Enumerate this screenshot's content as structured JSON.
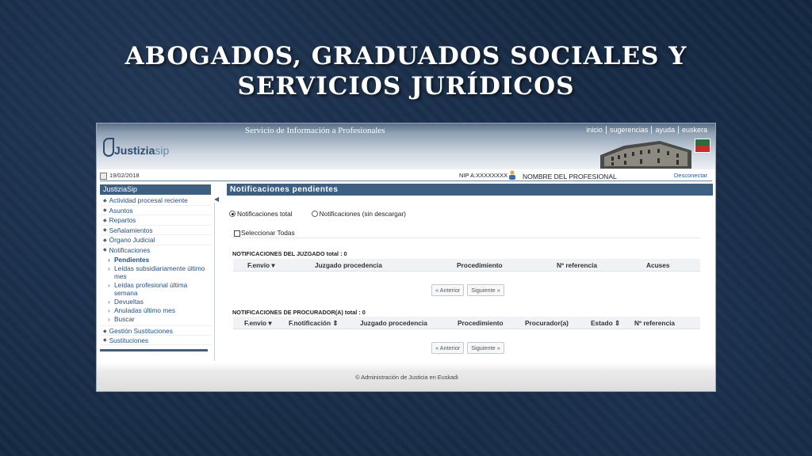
{
  "slide": {
    "title_line1": "ABOGADOS, GRADUADOS SOCIALES Y",
    "title_line2": "SERVICIOS JURÍDICOS"
  },
  "header": {
    "service": "Servicio de Información a Profesionales",
    "links": [
      "inicio",
      "sugerencias",
      "ayuda",
      "euskera"
    ],
    "logo_j": "Justizia",
    "logo_sip": "sip"
  },
  "infobar": {
    "date": "19/02/2018",
    "nip": "NIP A:XXXXXXXX",
    "professional": "NOMBRE DEL PROFESIONAL",
    "logout": "Desconectar"
  },
  "sidebar": {
    "title": "JustiziaSip",
    "items": [
      "Actividad procesal reciente",
      "Asuntos",
      "Repartos",
      "Señalamientos",
      "Órgano Judicial",
      "Notificaciones"
    ],
    "sub": [
      "Pendientes",
      "Leídas subsidiariamente último mes",
      "Leídas profesional última semana",
      "Devueltas",
      "Anuladas último mes",
      "Buscar"
    ],
    "items_after": [
      "Gestión Sustituciones",
      "Sustituciones"
    ]
  },
  "main": {
    "title": "Notificaciones pendientes",
    "radio_total": "Notificaciones total",
    "radio_sin": "Notificaciones (sin descargar)",
    "select_all": "Seleccionar Todas",
    "juzgado_title": "NOTIFICACIONES DEL JUZGADO total : 0",
    "juzgado_cols": [
      "F.envío ▾",
      "Juzgado procedencia",
      "Procedimiento",
      "Nº referencia",
      "Acuses"
    ],
    "procurador_title": "NOTIFICACIONES DE PROCURADOR(A) total : 0",
    "procurador_cols": [
      "F.envío ▾",
      "F.notificación ⇕",
      "Juzgado procedencia",
      "Procedimiento",
      "Procurador(a)",
      "Estado ⇕",
      "Nº referencia"
    ],
    "prev": "« Anterior",
    "next": "Siguiente »"
  },
  "footer": {
    "copyright": "© Administración de Justicia en Euskadi"
  }
}
